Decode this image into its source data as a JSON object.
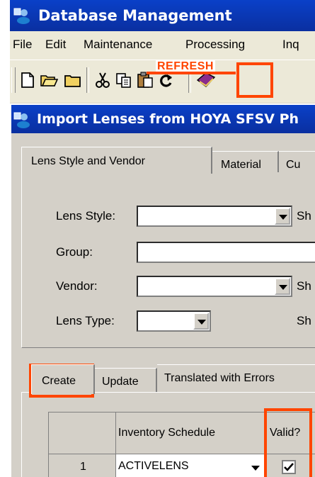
{
  "window": {
    "title": "Database Management"
  },
  "menu": [
    "File",
    "Edit",
    "Maintenance",
    "Processing",
    "Inq"
  ],
  "toolbar": {
    "refresh_annotation": "REFRESH"
  },
  "dialog": {
    "title": "Import Lenses from HOYA SFSV Ph"
  },
  "tabs": [
    "Lens Style and Vendor",
    "Material",
    "Cu"
  ],
  "fields": [
    {
      "label": "Lens Style:",
      "value": "",
      "suffix": "Sh"
    },
    {
      "label": "Group:",
      "value": "",
      "suffix": ""
    },
    {
      "label": "Vendor:",
      "value": "",
      "suffix": "Sh"
    },
    {
      "label": "Lens Type:",
      "value": "",
      "suffix": "Sh"
    }
  ],
  "bottom_tabs": [
    "Create",
    "Update",
    "Translated with Errors"
  ],
  "grid": {
    "headers": [
      "",
      "Inventory Schedule",
      "Valid?"
    ],
    "rows": [
      {
        "index": "1",
        "schedule": "ACTIVELENS",
        "valid": true
      }
    ]
  },
  "colors": {
    "accent": "#ff4500",
    "title_bar": "#0a40c8",
    "face": "#d4d0c8"
  }
}
